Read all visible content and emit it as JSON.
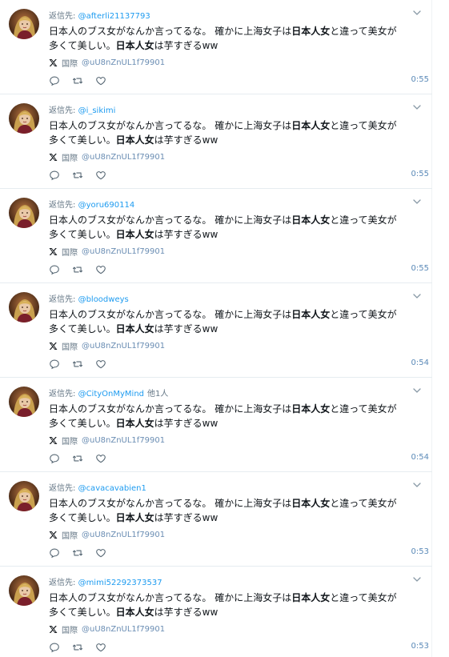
{
  "feed": {
    "reply_prefix": "返信先:",
    "body_part1": "日本人のブス女がなんか言ってるな。 確かに上海女子は",
    "body_bold1": "日本人女",
    "body_part2": "と違って美女が",
    "body_part3": "多くて美しい。",
    "body_bold2": "日本人女",
    "body_part4": "は芋すぎるww",
    "source_label": "国際",
    "source_handle": "@uU8nZnUL1f79901",
    "icons": {
      "source": "x-logo-icon",
      "reply": "reply-icon",
      "retweet": "retweet-icon",
      "like": "heart-icon",
      "menu": "chevron-down-icon"
    },
    "colors": {
      "link": "#1d9bf0",
      "muted": "#657786",
      "border": "#e6ecf0"
    },
    "tweets": [
      {
        "reply_to": "@afterli21137793",
        "others": "",
        "time": "0:55"
      },
      {
        "reply_to": "@i_sikimi",
        "others": "",
        "time": "0:55"
      },
      {
        "reply_to": "@yoru690114",
        "others": "",
        "time": "0:55"
      },
      {
        "reply_to": "@bloodweys",
        "others": "",
        "time": "0:54"
      },
      {
        "reply_to": "@CityOnMyMind",
        "others": "他1人",
        "time": "0:54"
      },
      {
        "reply_to": "@cavacavabien1",
        "others": "",
        "time": "0:53"
      },
      {
        "reply_to": "@mimi52292373537",
        "others": "",
        "time": "0:53"
      }
    ]
  }
}
